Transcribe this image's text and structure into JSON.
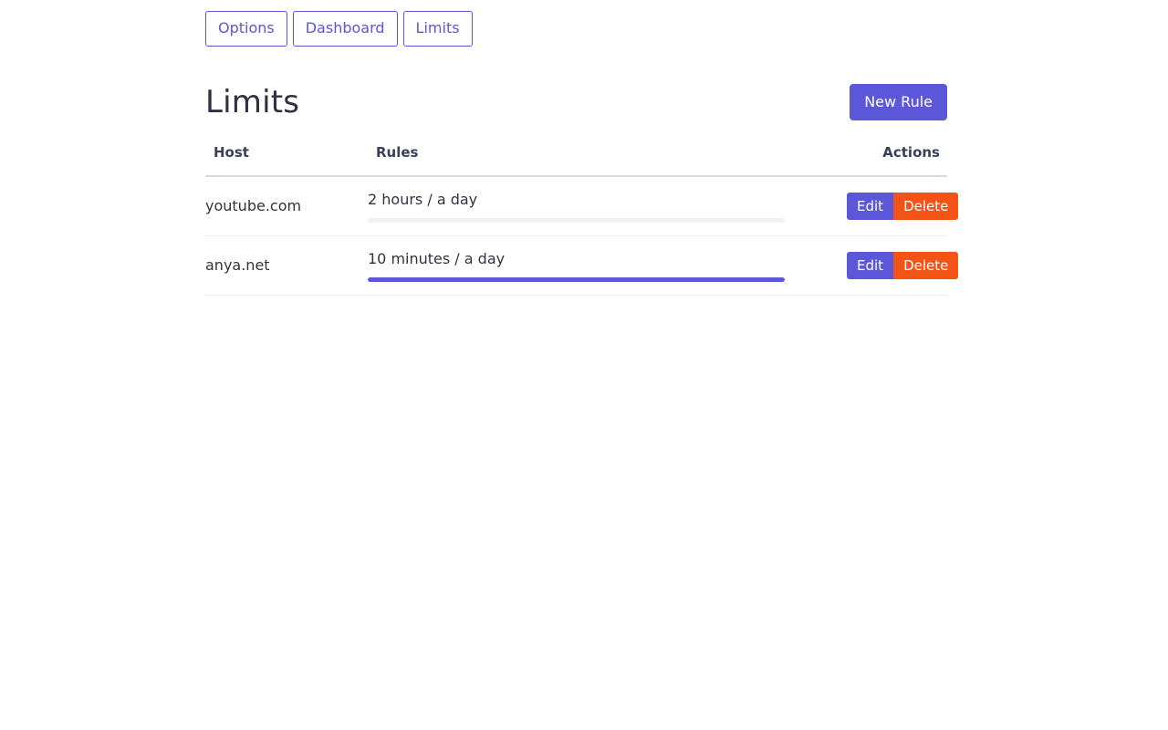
{
  "nav": {
    "tabs": [
      {
        "label": "Options"
      },
      {
        "label": "Dashboard"
      },
      {
        "label": "Limits"
      }
    ]
  },
  "header": {
    "title": "Limits",
    "new_rule_label": "New Rule"
  },
  "table": {
    "columns": {
      "host": "Host",
      "rules": "Rules",
      "actions": "Actions"
    },
    "rows": [
      {
        "host": "youtube.com",
        "rule": "2 hours / a day",
        "progress_percent": 0,
        "edit_label": "Edit",
        "delete_label": "Delete"
      },
      {
        "host": "anya.net",
        "rule": "10 minutes / a day",
        "progress_percent": 100,
        "edit_label": "Edit",
        "delete_label": "Delete"
      }
    ]
  },
  "colors": {
    "accent": "#5b57d8",
    "danger": "#f35314",
    "text": "#2f3440",
    "heading": "#39405a",
    "track": "#f0f1f5",
    "border_strong": "#d5dae0",
    "border_light": "#edeef3"
  }
}
